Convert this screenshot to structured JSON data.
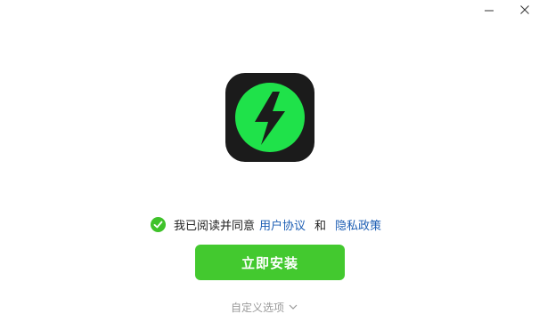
{
  "agreement": {
    "prefix": "我已阅读并同意",
    "user_agreement": "用户协议",
    "conjunction": "和",
    "privacy_policy": "隐私政策",
    "checked": true
  },
  "install": {
    "label": "立即安装"
  },
  "custom_options": {
    "label": "自定义选项"
  },
  "icons": {
    "app": "lightning-bolt-icon",
    "minimize": "minimize-icon",
    "close": "close-icon",
    "checkbox": "check-circle-icon",
    "expand": "chevron-down-icon"
  },
  "colors": {
    "accent_green": "#43c92f",
    "icon_green": "#1fe24a",
    "icon_bg": "#1b1b1b",
    "link_blue": "#1e5fb4"
  }
}
